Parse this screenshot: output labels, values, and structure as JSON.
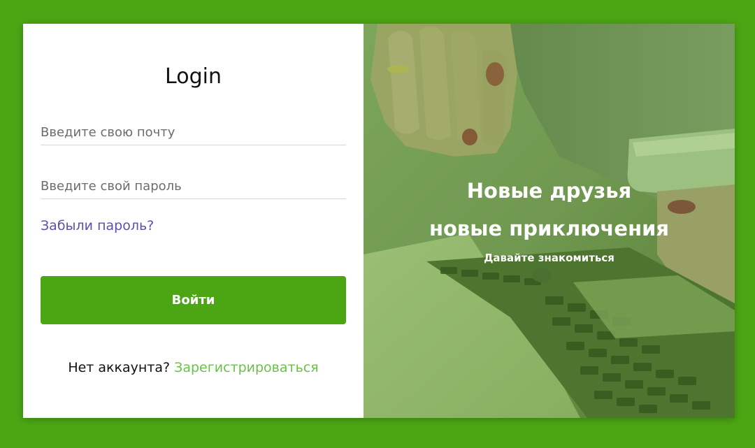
{
  "login": {
    "title": "Login",
    "email_placeholder": "Введите свою почту",
    "password_placeholder": "Введите свой пароль",
    "forgot_password": "Забыли пароль?",
    "submit_label": "Войти",
    "no_account_text": "Нет аккаунта?",
    "signup_link": "Зарегистрироваться"
  },
  "hero": {
    "line1": "Новые друзья",
    "line2": "новые приключения",
    "subtitle": "Давайте знакомиться",
    "image": "laptop-and-phone-photo"
  },
  "colors": {
    "background": "#4ca614",
    "button": "#4ca614",
    "forgot_link": "#5b4fb0",
    "signup_link": "#6cc04a"
  }
}
